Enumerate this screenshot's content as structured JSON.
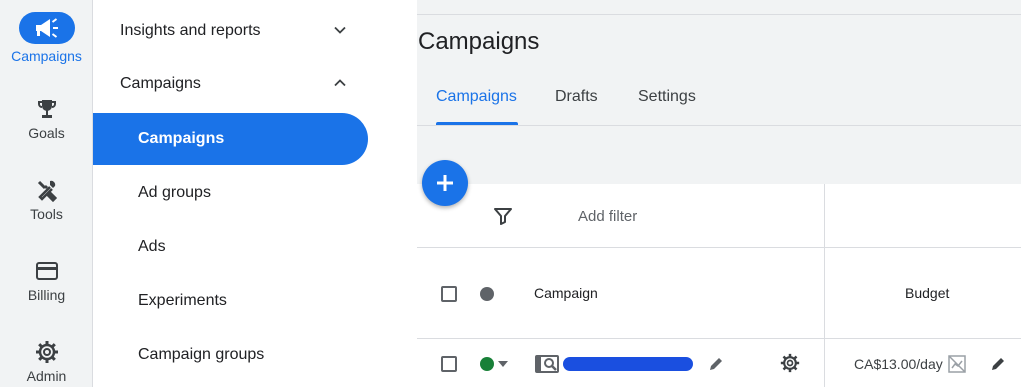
{
  "rail": {
    "items": [
      {
        "label": "Campaigns",
        "icon": "megaphone-icon",
        "active": true
      },
      {
        "label": "Goals",
        "icon": "trophy-icon"
      },
      {
        "label": "Tools",
        "icon": "tools-icon"
      },
      {
        "label": "Billing",
        "icon": "credit-card-icon"
      },
      {
        "label": "Admin",
        "icon": "gear-icon"
      }
    ]
  },
  "nav": {
    "sections": [
      {
        "label": "Insights and reports",
        "state": "collapsed"
      },
      {
        "label": "Campaigns",
        "state": "expanded"
      }
    ],
    "items": [
      {
        "label": "Campaigns",
        "active": true
      },
      {
        "label": "Ad groups"
      },
      {
        "label": "Ads"
      },
      {
        "label": "Experiments"
      },
      {
        "label": "Campaign groups"
      }
    ]
  },
  "main": {
    "title": "Campaigns",
    "tabs": [
      {
        "label": "Campaigns",
        "active": true
      },
      {
        "label": "Drafts"
      },
      {
        "label": "Settings"
      }
    ],
    "filter": {
      "label": "Add filter"
    },
    "table": {
      "columns": [
        "Campaign",
        "Budget"
      ],
      "rows": [
        {
          "campaign": "",
          "budget": "CA$13.00/day",
          "status_color": "#188038"
        }
      ]
    }
  },
  "colors": {
    "accent": "#1a73e8",
    "status_enabled": "#188038",
    "status_header": "#5f6368"
  }
}
